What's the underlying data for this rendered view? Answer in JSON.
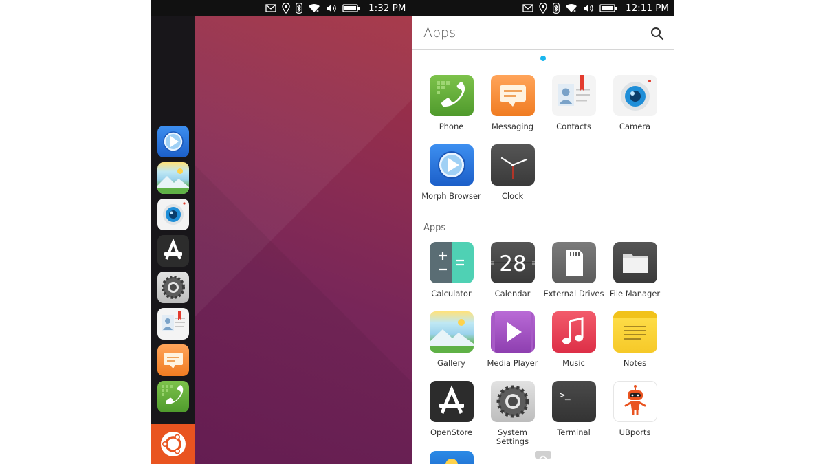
{
  "left_screen": {
    "status": {
      "time": "1:32 PM"
    },
    "launcher": [
      {
        "name": "Morph Browser",
        "icon": "browser-icon"
      },
      {
        "name": "Gallery",
        "icon": "gallery-icon"
      },
      {
        "name": "Camera",
        "icon": "camera-icon"
      },
      {
        "name": "OpenStore",
        "icon": "openstore-icon"
      },
      {
        "name": "System Settings",
        "icon": "settings-icon"
      },
      {
        "name": "Contacts",
        "icon": "contacts-icon"
      },
      {
        "name": "Messaging",
        "icon": "messaging-icon"
      },
      {
        "name": "Phone",
        "icon": "phone-icon"
      }
    ]
  },
  "right_screen": {
    "status": {
      "time": "12:11 PM"
    },
    "header": {
      "title": "Apps"
    },
    "favorites": [
      {
        "label": "Phone",
        "icon": "phone-icon"
      },
      {
        "label": "Messaging",
        "icon": "messaging-icon"
      },
      {
        "label": "Contacts",
        "icon": "contacts-icon"
      },
      {
        "label": "Camera",
        "icon": "camera-icon"
      },
      {
        "label": "Morph Browser",
        "icon": "browser-icon"
      },
      {
        "label": "Clock",
        "icon": "clock-icon"
      }
    ],
    "section_label": "Apps",
    "apps": [
      {
        "label": "Calculator",
        "icon": "calculator-icon"
      },
      {
        "label": "Calendar",
        "icon": "calendar-icon",
        "day": "28"
      },
      {
        "label": "External Drives",
        "icon": "sd-card-icon"
      },
      {
        "label": "File Manager",
        "icon": "folder-icon"
      },
      {
        "label": "Gallery",
        "icon": "gallery-icon"
      },
      {
        "label": "Media Player",
        "icon": "play-icon"
      },
      {
        "label": "Music",
        "icon": "music-icon"
      },
      {
        "label": "Notes",
        "icon": "notes-icon"
      },
      {
        "label": "OpenStore",
        "icon": "openstore-icon"
      },
      {
        "label": "System Settings",
        "icon": "settings-icon"
      },
      {
        "label": "Terminal",
        "icon": "terminal-icon",
        "prompt": ">_"
      },
      {
        "label": "UBports",
        "icon": "ubports-robot-icon"
      }
    ]
  },
  "colors": {
    "ubuntu_orange": "#e95420",
    "accent_blue": "#19b6ee",
    "launcher_bg": "#18161a"
  }
}
